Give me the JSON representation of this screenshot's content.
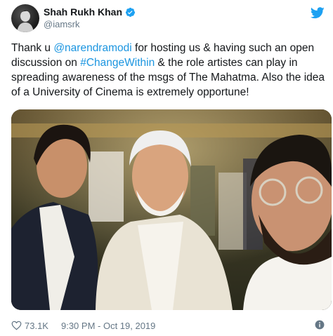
{
  "tweet": {
    "author_name": "Shah Rukh Khan",
    "handle": "@iamsrk",
    "text_parts": {
      "p1": "Thank u ",
      "mention": "@narendramodi",
      "p2": " for hosting us & having such an open discussion on ",
      "hashtag": "#ChangeWithin",
      "p3": " & the role artistes can play in spreading awareness of the msgs of The Mahatma. Also the idea of a University of Cinema is extremely opportune!"
    },
    "likes": "73.1K",
    "timestamp": "9:30 PM - Oct 19, 2019"
  },
  "icons": {
    "verified": "verified-badge-icon",
    "bird": "twitter-bird-icon",
    "heart": "heart-icon",
    "info": "info-icon"
  },
  "colors": {
    "link": "#1b95e0",
    "brand": "#1da1f2",
    "muted": "#657786"
  }
}
